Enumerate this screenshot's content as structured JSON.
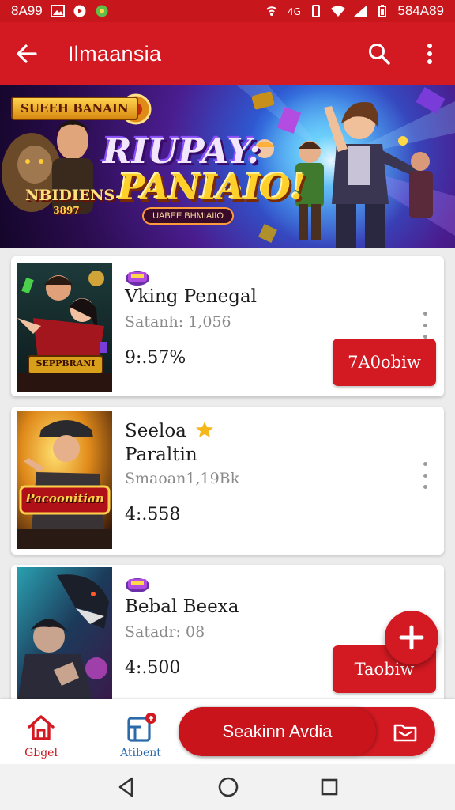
{
  "status_bar": {
    "time_left": "8A99",
    "right_text": "584A89"
  },
  "app_bar": {
    "title": "Ilmaansia"
  },
  "banner": {
    "badge_top": "SUEEH BANAIN",
    "badge_left_line1": "NBIDIENS",
    "badge_left_line2": "3897",
    "logo_line1": "RIUPAY:",
    "logo_line2": "PANIAIO!",
    "pill_text": "UABEE BHMIAIIO"
  },
  "items": [
    {
      "name": "Vking Penegal",
      "meta": "Satanh: 1,056",
      "price": "9:.57%",
      "button": "7A0obiw",
      "thumb_text": "SEPPBRANI"
    },
    {
      "name_line1": "Seeloa",
      "name_line2": "Paraltin",
      "meta": "Smaoan1,19Bk",
      "price": "4:.558",
      "thumb_text": "Pacoonitian"
    },
    {
      "name": "Bebal Beexa",
      "meta": "Satadr: 08",
      "price": "4:.500",
      "button": "Taobiw"
    }
  ],
  "bottom_nav": {
    "home_label": "Gbgel",
    "second_label": "Atibent",
    "action_label": "Seakinn Avdia"
  },
  "colors": {
    "primary": "#d31a22",
    "status_bar": "#c8161d"
  }
}
